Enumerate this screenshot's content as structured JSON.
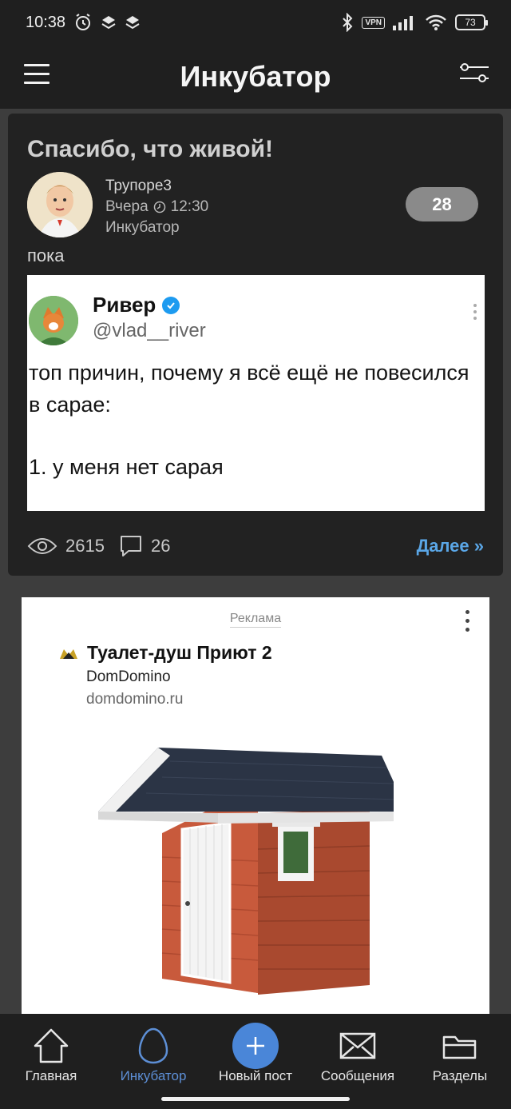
{
  "status_bar": {
    "time": "10:38",
    "vpn": "VPN",
    "battery": "73"
  },
  "header": {
    "title": "Инкубатор"
  },
  "post": {
    "title": "Спасибо, что живой!",
    "author": "Трупоре3",
    "date": "Вчера",
    "time": "12:30",
    "section": "Инкубатор",
    "rating": "28",
    "text": "пока",
    "views": "2615",
    "comments": "26",
    "more_link": "Далее »",
    "embedded_tweet": {
      "name": "Ривер",
      "handle": "@vlad__river",
      "line1": "топ причин, почему я всё ещё не повесился в сарае:",
      "line2": "1. у меня нет сарая"
    }
  },
  "ad": {
    "label": "Реклама",
    "title": "Туалет-душ Приют 2",
    "brand": "DomDomino",
    "domain": "domdomino.ru"
  },
  "bottom_nav": {
    "items": [
      {
        "label": "Главная",
        "icon": "home-icon"
      },
      {
        "label": "Инкубатор",
        "icon": "egg-icon"
      },
      {
        "label": "Новый пост",
        "icon": "plus-icon"
      },
      {
        "label": "Сообщения",
        "icon": "envelope-icon"
      },
      {
        "label": "Разделы",
        "icon": "folder-icon"
      }
    ]
  },
  "colors": {
    "background": "#3d3d3d",
    "bar": "#1f1f1f",
    "card": "#222222",
    "accent": "#5aa6e6",
    "active_tab": "#5d8fd6"
  }
}
